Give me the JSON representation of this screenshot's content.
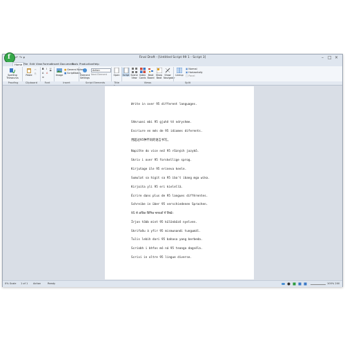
{
  "window": {
    "title": "Final Draft - [Untitled Script 99 1 - Script 3]",
    "quick_access": "↶ ↷ ▾"
  },
  "menu_tabs": [
    "Home",
    "File",
    "Edit",
    "View",
    "Format",
    "Insert",
    "Document",
    "Tools",
    "Production",
    "Help"
  ],
  "ribbon": {
    "spelling": "Spelling Thesaurus",
    "paste": "Paste",
    "image": "Image",
    "general_notes": "General Notes",
    "scriptnotes": "ScriptNotes",
    "element_select": "Action",
    "element_settings": "Element Settings",
    "next_element": "Next Element",
    "open": "Open",
    "buttons": [
      "Script",
      "Scene View",
      "Index Cards",
      "Beat Board",
      "Show Beat",
      "Show Navigator",
      "Lineup"
    ],
    "view_options": [
      "Normal",
      "Horizontally",
      "Panel"
    ]
  },
  "group_labels": {
    "proofing": "Proofing",
    "clipboard": "Clipboard",
    "font": "Font",
    "insert": "Insert",
    "script_elements": "Script Elements",
    "title_page": "Title Page",
    "views": "Views",
    "split": "Split"
  },
  "document": {
    "lines": [
      "Write in over 95 different languages.",
      "Shkruani mbi 95 gjuhë të ndryshme.",
      "Escriure en més de 95 idiomes diferents.",
      "用超过95种不同的语言书写。",
      "Napište do více než 95 různých jazyků.",
      "Skriv i over 95 forskellige sprog.",
      "Kirjutage üle 95 erineva keele.",
      "Sumulat sa higit sa 95 iba't ibang mga wika.",
      "Kirjoita yli 95 eri kielellä.",
      "Écrire dans plus de 95 langues différentes.",
      "Schreibe in über 95 verschiedenen Sprachen.",
      "95 से अधिक विभिन्न भाषाओं में लिखें।",
      "Írjon több mint 95 különböző nyelven.",
      "Skrifaðu á yfir 95 mismunandi tungumál.",
      "Tulis lebih dari 95 bahasa yang berbeda.",
      "Scríobh i bhfos mó ná 95 teanga dagséla.",
      "Scrivi in oltre 95 lingue diverse."
    ]
  },
  "status": {
    "scale": "0% Scale",
    "page": "1 of 1",
    "element": "Action",
    "state": "Ready",
    "zoom": "100%  200"
  }
}
